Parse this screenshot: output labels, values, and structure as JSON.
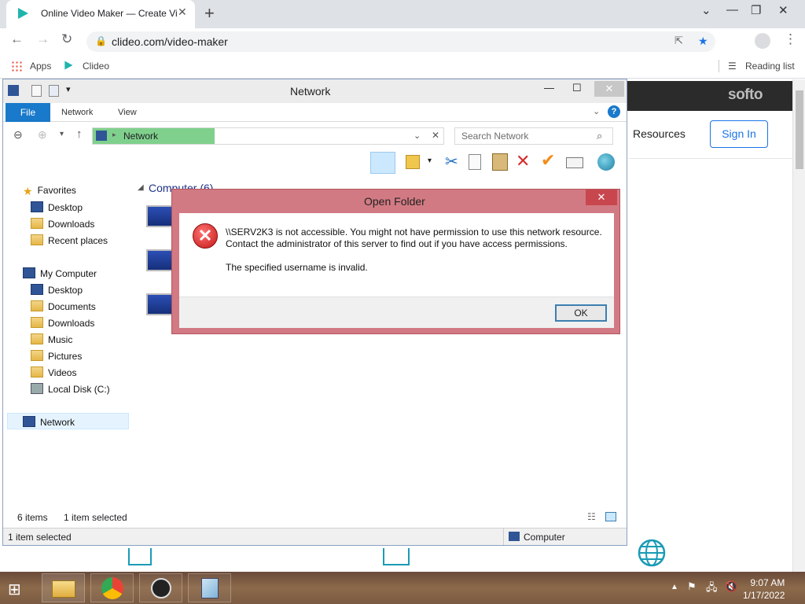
{
  "browser": {
    "tab_title": "Online Video Maker — Create Vi",
    "url": "clideo.com/video-maker",
    "bookmarks": {
      "apps": "Apps",
      "clideo": "Clideo",
      "reading_list": "Reading list"
    }
  },
  "webpage": {
    "brand": "softo",
    "resources": "Resources",
    "sign_in": "Sign In"
  },
  "explorer": {
    "title": "Network",
    "ribbon_tabs": {
      "file": "File",
      "network": "Network",
      "view": "View"
    },
    "address": "Network",
    "search_placeholder": "Search Network",
    "section_header": "Computer (6)",
    "nav": {
      "favorites": "Favorites",
      "fav_desktop": "Desktop",
      "fav_downloads": "Downloads",
      "fav_recent": "Recent places",
      "my_computer": "My Computer",
      "mc_desktop": "Desktop",
      "mc_documents": "Documents",
      "mc_downloads": "Downloads",
      "mc_music": "Music",
      "mc_pictures": "Pictures",
      "mc_videos": "Videos",
      "mc_disk": "Local Disk (C:)",
      "network": "Network"
    },
    "status": {
      "items": "6 items",
      "selected": "1 item selected",
      "bottom_selected": "1 item selected",
      "location": "Computer"
    }
  },
  "dialog": {
    "title": "Open Folder",
    "line1": "\\\\SERV2K3 is not accessible. You might not have permission to use this network resource.",
    "line2": "Contact the administrator of this server to find out if you have access permissions.",
    "line3": "The specified username is invalid.",
    "ok": "OK"
  },
  "taskbar": {
    "time": "9:07 AM",
    "date": "1/17/2022"
  }
}
